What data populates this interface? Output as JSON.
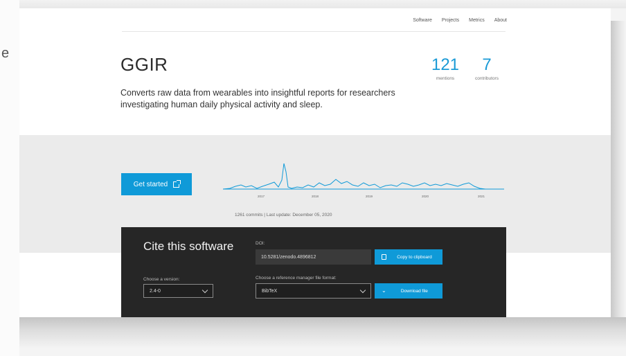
{
  "nav": {
    "items": [
      "Software",
      "Projects",
      "Metrics",
      "About"
    ]
  },
  "header": {
    "title": "GGIR",
    "description": "Converts raw data from wearables into insightful reports for researchers investigating human daily physical activity and sleep.",
    "edge_glyph": "e"
  },
  "stats": {
    "mentions_value": "121",
    "mentions_label": "mentions",
    "contributors_value": "7",
    "contributors_label": "contributors"
  },
  "actions": {
    "get_started_label": "Get started"
  },
  "commits": {
    "meta": "1261 commits | Last update: December 05, 2020",
    "year_labels": [
      "2017",
      "2018",
      "2019",
      "2020",
      "2021"
    ]
  },
  "cite": {
    "title": "Cite this software",
    "doi_label": "DOI:",
    "doi_value": "10.5281/zenodo.4896812",
    "copy_label": "Copy to clipboard",
    "version_label": "Choose a version:",
    "version_value": "2.4-0",
    "format_label": "Choose a reference manager file format:",
    "format_value": "BibTeX",
    "download_label": "Download file"
  },
  "colors": {
    "accent": "#0f9ad8",
    "cite_bg": "#262626",
    "band_bg": "#ebebeb"
  }
}
